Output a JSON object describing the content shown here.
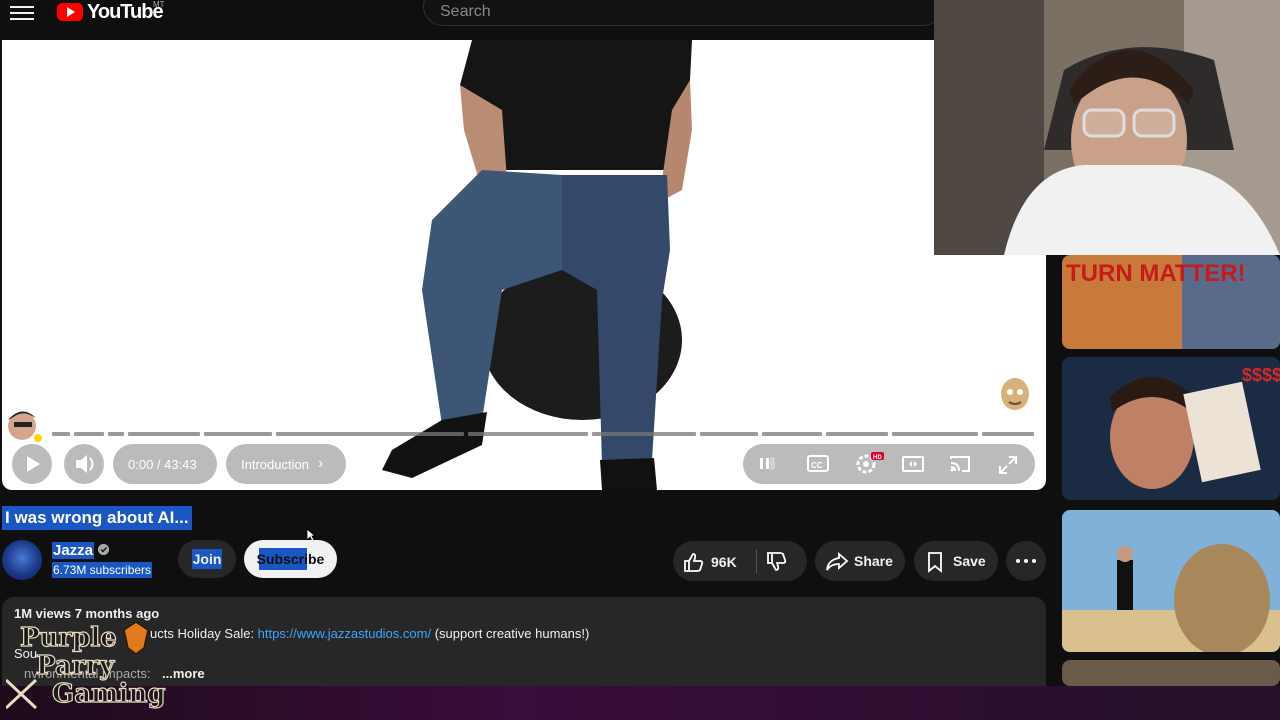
{
  "header": {
    "logo_text": "YouTube",
    "logo_sup": "MT",
    "search_placeholder": "Search"
  },
  "player": {
    "time": "0:00 / 43:43",
    "chapter": "Introduction",
    "chapter_chevron": "›",
    "progress_fraction": 0.0
  },
  "video": {
    "title": "I was wrong about AI...",
    "channel_name": "Jazza",
    "subscribers": "6.73M subscribers",
    "join_label": "Join",
    "subscribe_label": "Subscribe",
    "likes": "96K",
    "share_label": "Share",
    "save_label": "Save"
  },
  "description": {
    "views_date": "1M views  7 months ago",
    "line1_prefix": "ucts Holiday Sale: ",
    "link": "https://www.jazzastudios.com/",
    "line1_suffix": " (support creative humans!)",
    "line2": "Sou",
    "line3": "nvironmental impacts: ",
    "more": "...more"
  },
  "sidebar": {
    "thumb1_text": "TURN MATTER!",
    "thumb2_text": "$$$$"
  },
  "overlay": {
    "brand_line1": "Purple",
    "brand_line2": "Parry",
    "brand_line3": "Gaming"
  },
  "icons": [
    "menu-icon",
    "youtube-logo-icon",
    "play-icon",
    "volume-icon",
    "pause-icon",
    "cc-icon",
    "settings-icon",
    "theater-icon",
    "cast-icon",
    "fullscreen-icon",
    "like-icon",
    "dislike-icon",
    "share-icon",
    "save-icon",
    "more-options-icon",
    "verified-icon"
  ],
  "colors": {
    "background": "#0f0f0f",
    "selection": "#1a56c4",
    "link": "#3ea6ff",
    "brand_red": "#ff0000"
  }
}
